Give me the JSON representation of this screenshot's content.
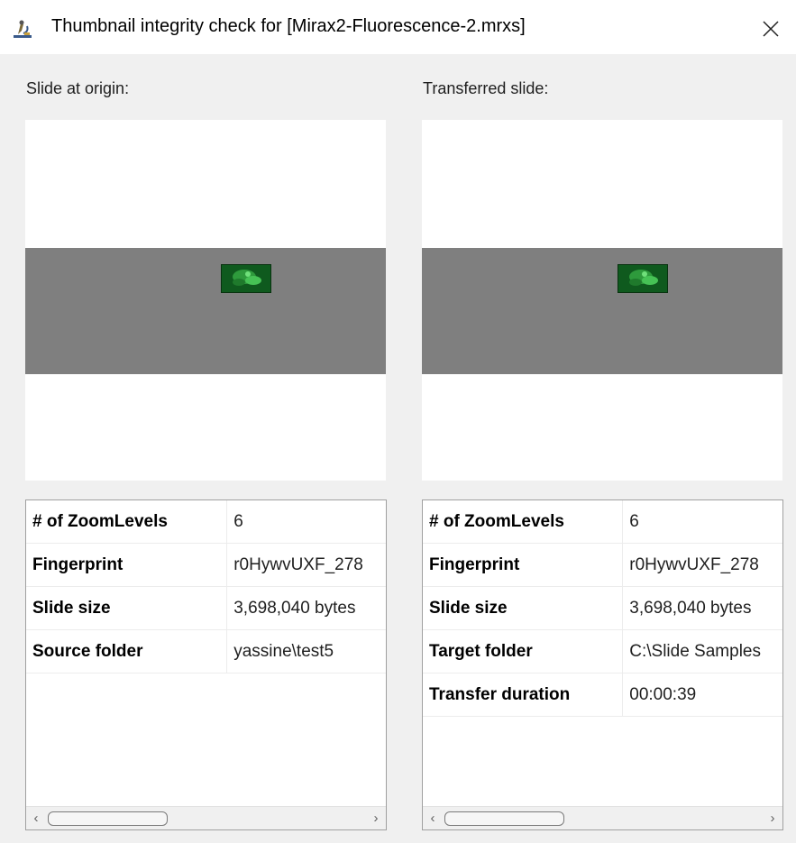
{
  "window": {
    "title": "Thumbnail integrity check for [Mirax2-Fluorescence-2.mrxs]",
    "app_icon": "microscope-icon",
    "close_icon": "close-icon"
  },
  "origin": {
    "label": "Slide at origin:",
    "rows": [
      {
        "key": "# of ZoomLevels",
        "value": "6"
      },
      {
        "key": "Fingerprint",
        "value": "r0HywvUXF_278"
      },
      {
        "key": "Slide size",
        "value": "3,698,040 bytes"
      },
      {
        "key": "Source folder",
        "value": "yassine\\test5"
      }
    ]
  },
  "transferred": {
    "label": "Transferred slide:",
    "rows": [
      {
        "key": "# of ZoomLevels",
        "value": "6"
      },
      {
        "key": "Fingerprint",
        "value": "r0HywvUXF_278"
      },
      {
        "key": "Slide size",
        "value": "3,698,040 bytes"
      },
      {
        "key": "Target folder",
        "value": "C:\\Slide Samples"
      },
      {
        "key": "Transfer duration",
        "value": "00:00:39"
      }
    ]
  },
  "scrollbar": {
    "left_arrow": "‹",
    "right_arrow": "›"
  },
  "colors": {
    "slide_band": "#7f7f7f",
    "tissue": "#0f5a1e",
    "window_bg": "#f0f0f0"
  }
}
